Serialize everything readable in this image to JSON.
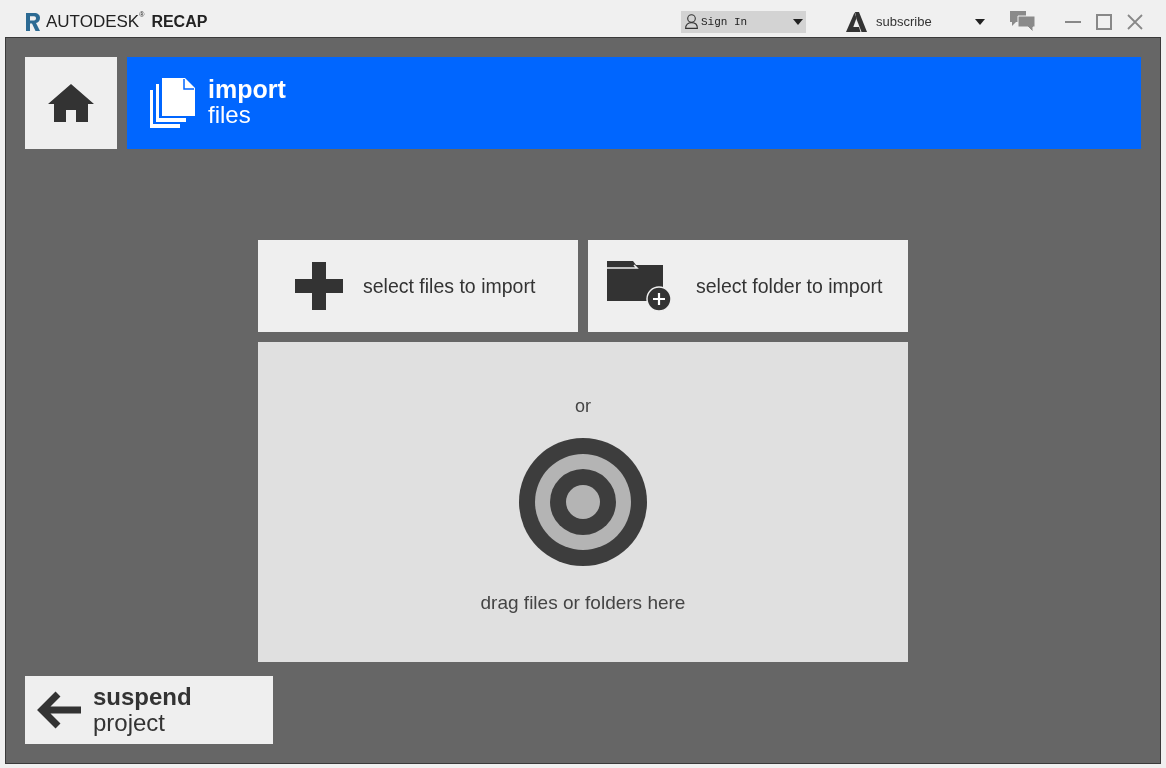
{
  "title_bar": {
    "brand": "AUTODESK$^{®}$",
    "product": "RECAP",
    "sign_in": {
      "label": "Sign In"
    },
    "subscribe": {
      "label": "subscribe"
    }
  },
  "header": {
    "title": "import",
    "subtitle": "files"
  },
  "actions": [
    {
      "kind": "files",
      "label": "select files to import"
    },
    {
      "kind": "folder",
      "label": "select folder to import"
    }
  ],
  "drop_zone": {
    "separator": "or",
    "hint": "drag files or folders here"
  },
  "footer": {
    "title": "suspend",
    "subtitle": "project"
  }
}
